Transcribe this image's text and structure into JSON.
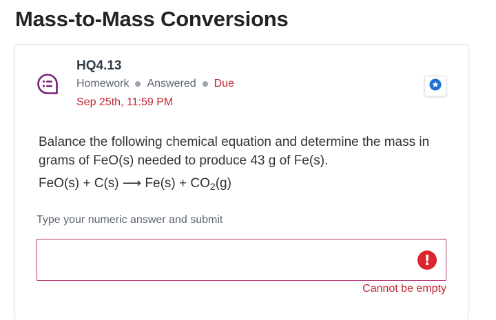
{
  "page": {
    "title": "Mass-to-Mass Conversions"
  },
  "question": {
    "code": "HQ4.13",
    "type": "Homework",
    "status": "Answered",
    "due_label": "Due",
    "due_date": "Sep 25th, 11:59 PM",
    "text": "Balance the following chemical equation and determine the mass in grams of FeO(s) needed to produce 43 g of Fe(s).",
    "equation": {
      "part1": "FeO(s) + C(s) ⟶ Fe(s) + CO",
      "subscript": "2",
      "part2": "(g)"
    }
  },
  "answer": {
    "prompt": "Type your numeric answer and submit",
    "value": "",
    "error_message": "Cannot be empty",
    "error_icon_glyph": "!"
  },
  "icons": {
    "question_icon": "question-list-icon",
    "star_button": "star-icon",
    "error": "error-icon"
  },
  "colors": {
    "accent_purple": "#7a1f73",
    "error_red": "#c0262f",
    "star_blue": "#1f6fd6"
  }
}
